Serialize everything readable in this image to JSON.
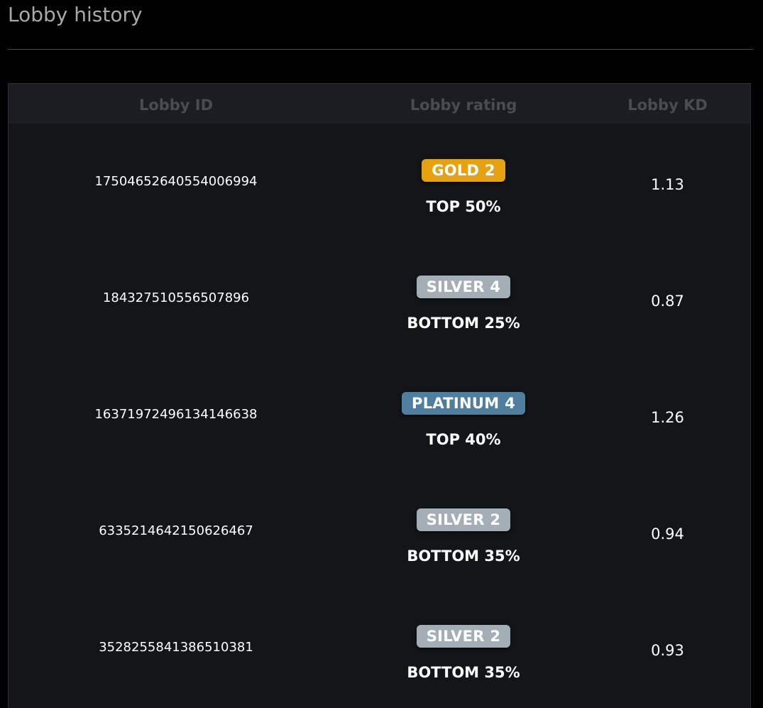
{
  "page": {
    "title": "Lobby history"
  },
  "table": {
    "columns": [
      "Lobby ID",
      "Lobby rating",
      "Lobby KD"
    ],
    "rows": [
      {
        "lobby_id": "17504652640554006994",
        "tier": "GOLD 2",
        "tier_color": "#e5a10f",
        "rank": "TOP 50%",
        "kd": "1.13"
      },
      {
        "lobby_id": "184327510556507896",
        "tier": "SILVER 4",
        "tier_color": "#a3aeb7",
        "rank": "BOTTOM 25%",
        "kd": "0.87"
      },
      {
        "lobby_id": "16371972496134146638",
        "tier": "PLATINUM 4",
        "tier_color": "#4f7e9f",
        "rank": "TOP 40%",
        "kd": "1.26"
      },
      {
        "lobby_id": "6335214642150626467",
        "tier": "SILVER 2",
        "tier_color": "#a3aeb7",
        "rank": "BOTTOM 35%",
        "kd": "0.94"
      },
      {
        "lobby_id": "3528255841386510381",
        "tier": "SILVER 2",
        "tier_color": "#a3aeb7",
        "rank": "BOTTOM 35%",
        "kd": "0.93"
      }
    ]
  }
}
